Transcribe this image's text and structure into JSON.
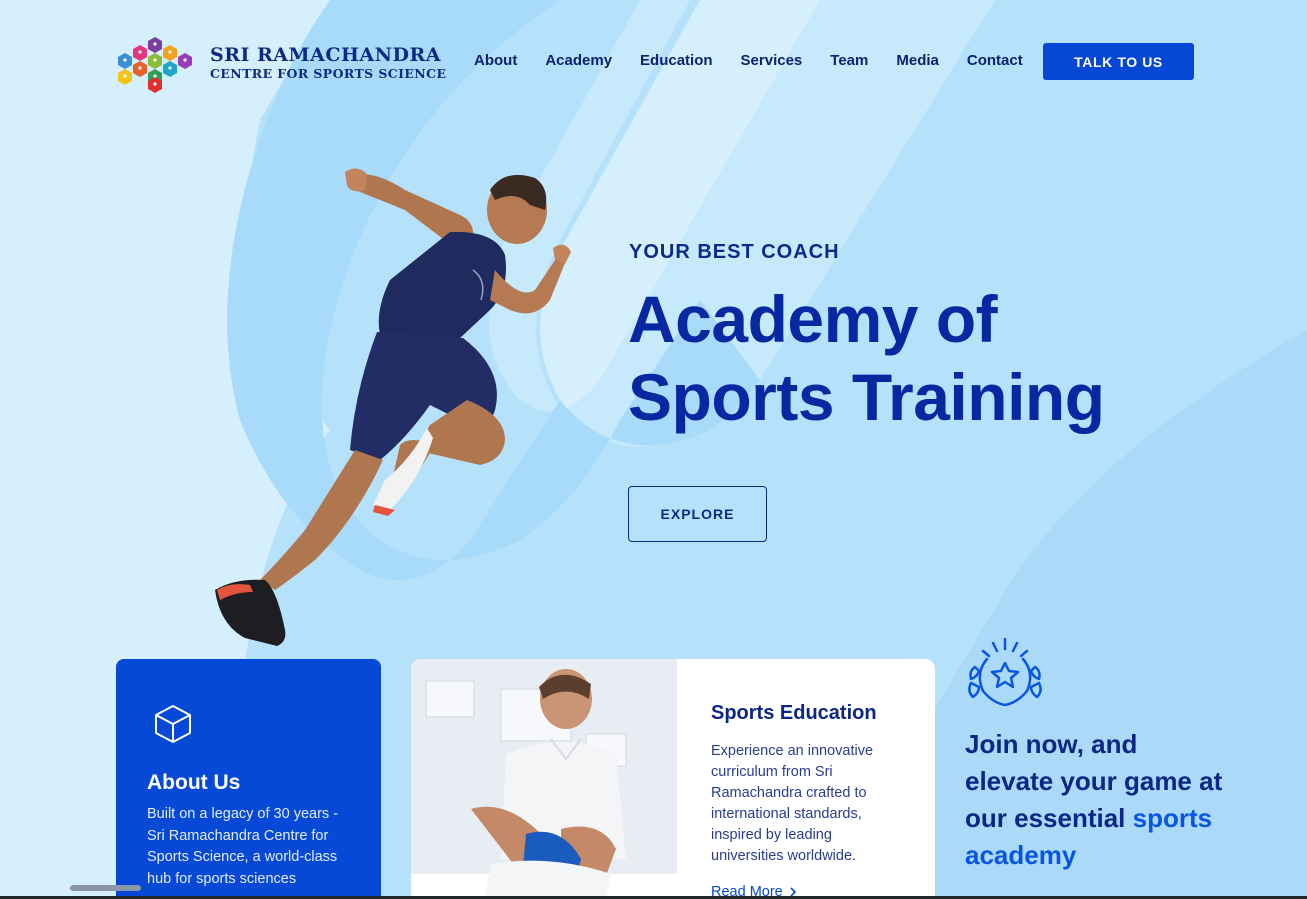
{
  "brand": {
    "name_line1": "SRI RAMACHANDRA",
    "name_line2": "CENTRE FOR SPORTS SCIENCE",
    "logo_icon": "hexagon-cluster-sports-logo"
  },
  "nav": {
    "items": [
      "About",
      "Academy",
      "Education",
      "Services",
      "Team",
      "Media",
      "Contact"
    ],
    "cta_label": "TALK TO US"
  },
  "hero": {
    "eyebrow": "YOUR BEST COACH",
    "title_line1": "Academy of",
    "title_line2": "Sports Training",
    "explore_label": "EXPLORE"
  },
  "cards": {
    "about": {
      "icon": "cube-icon",
      "title": "About Us",
      "body": "Built on a legacy of 30 years - Sri Ramachandra Centre for Sports Science, a world-class hub for sports sciences"
    },
    "education": {
      "title": "Sports Education",
      "body": "Experience an innovative curriculum from Sri Ramachandra crafted to international standards, inspired by leading universities worldwide.",
      "link_label": "Read More"
    }
  },
  "join": {
    "icon": "laurel-star-icon",
    "text_main": "Join now, and elevate your game at our essential",
    "text_highlight": "sports academy"
  },
  "colors": {
    "primary": "#0649d6",
    "navy": "#0b2685",
    "background": "#d6effc",
    "swoosh": "#a9dcfa"
  }
}
